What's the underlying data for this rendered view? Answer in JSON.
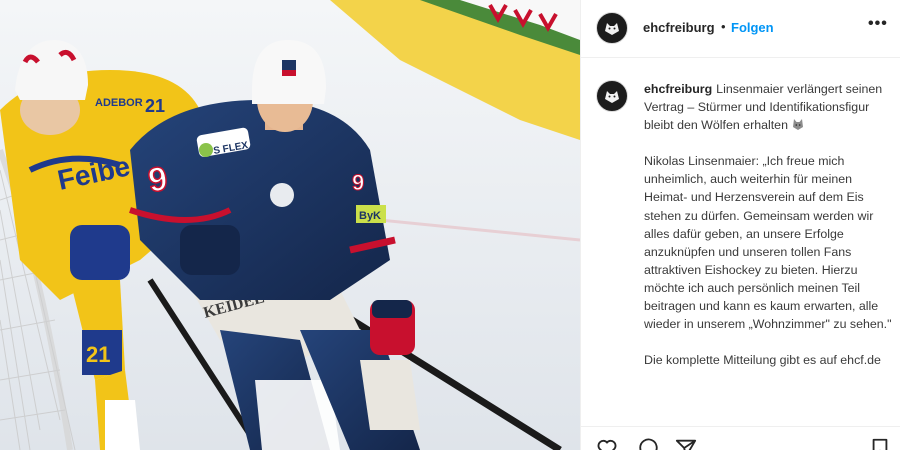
{
  "post": {
    "username": "ehcfreiburg",
    "separator": "•",
    "follow_label": "Folgen",
    "more_label": "•••"
  },
  "caption": {
    "username": "ehcfreiburg",
    "headline": "Linsenmaier verlängert seinen Vertrag – Stürmer und Identifikationsfigur bleibt den Wölfen erhalten",
    "quote": "Nikolas Linsenmaier: „Ich freue mich unheimlich, auch weiterhin für meinen Heimat- und Herzensverein auf dem Eis stehen zu dürfen. Gemeinsam werden wir alles dafür geben, an unsere Erfolge anzuknüpfen und unseren tollen Fans attraktiven Eishockey zu bieten. Hierzu möchte ich auch persönlich meinen Teil beitragen und kann es kaum erwarten, alle wieder in unserem „Wohnzimmer\" zu sehen.\"",
    "footer": "Die komplette Mitteilung gibt es auf ehcf.de"
  },
  "photo": {
    "home_jersey_number": "9",
    "away_jersey_number_sleeve": "21",
    "away_jersey_number_leg": "21",
    "sponsor_sfx": "S FLEX",
    "sponsor_keidel": "KEIDEL",
    "sponsor_byk": "ByK",
    "sponsor_kaderbor": "ADEBOR",
    "colors": {
      "home_jersey": "#1d3563",
      "home_accent": "#c8102e",
      "away_jersey": "#f2c418",
      "away_accent": "#1f3a8c",
      "ice": "#eef2f5",
      "board_yellow": "#f3d34a"
    }
  },
  "icons": {
    "like": "heart-icon",
    "comment": "comment-icon",
    "share": "paper-plane-icon",
    "save": "bookmark-icon",
    "more": "more-horizontal-icon",
    "avatar": "wolf-logo"
  }
}
